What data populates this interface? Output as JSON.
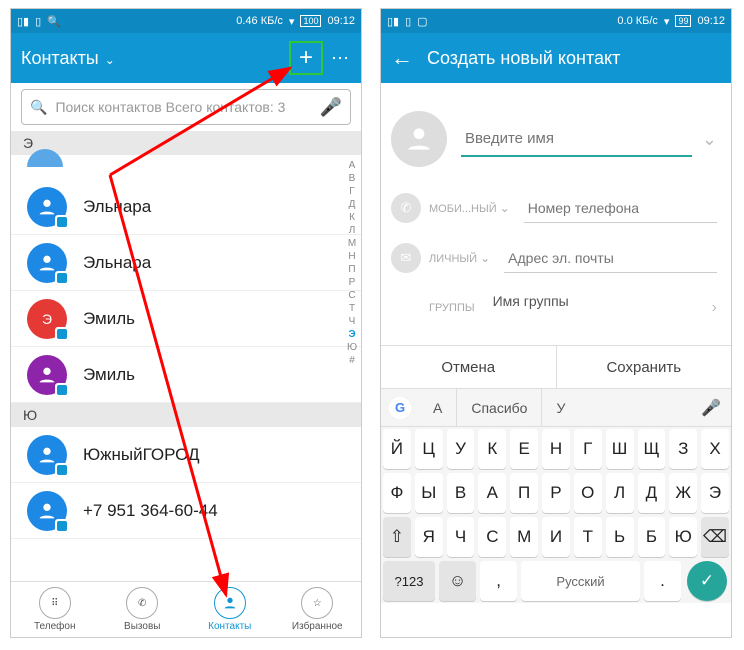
{
  "statusbar": {
    "data_rate_left": "0.46 КБ/с",
    "data_rate_right": "0.0 КБ/с",
    "battery_left": "100",
    "battery_right": "99",
    "time": "09:12"
  },
  "left": {
    "title": "Контакты",
    "search_placeholder": "Поиск контактов Всего контактов: 3",
    "sections": {
      "e_header": "Э",
      "yu_header": "Ю"
    },
    "contacts": [
      {
        "name": "Эльнара",
        "color": "#1e88e5"
      },
      {
        "name": "Эльнара",
        "color": "#1e88e5"
      },
      {
        "name": "Эмиль",
        "color": "#e53935"
      },
      {
        "name": "Эмиль",
        "color": "#8e24aa"
      },
      {
        "name": "ЮжныйГОРОД",
        "color": "#1e88e5"
      },
      {
        "name": "+7 951 364-60-44",
        "color": "#1e88e5"
      }
    ],
    "index": [
      "А",
      "В",
      "Г",
      "Д",
      "К",
      "Л",
      "М",
      "Н",
      "П",
      "Р",
      "С",
      "Т",
      "Ч",
      "Э",
      "Ю",
      "#"
    ],
    "nav": {
      "phone": "Телефон",
      "calls": "Вызовы",
      "contacts": "Контакты",
      "fav": "Избранное"
    }
  },
  "right": {
    "title": "Создать новый контакт",
    "name_placeholder": "Введите имя",
    "mobile_label": "МОБИ...НЫЙ",
    "mobile_placeholder": "Номер телефона",
    "email_label": "ЛИЧНЫЙ",
    "email_placeholder": "Адрес эл. почты",
    "groups_label": "ГРУППЫ",
    "groups_value": "Имя группы",
    "cancel": "Отмена",
    "save": "Сохранить",
    "suggestions": {
      "a": "А",
      "spasibo": "Спасибо",
      "u": "У"
    },
    "keyboard": {
      "r1": [
        "Й",
        "Ц",
        "У",
        "К",
        "Е",
        "Н",
        "Г",
        "Ш",
        "Щ",
        "З",
        "Х"
      ],
      "r2": [
        "Ф",
        "Ы",
        "В",
        "А",
        "П",
        "Р",
        "О",
        "Л",
        "Д",
        "Ж",
        "Э"
      ],
      "r3_shift": "⇧",
      "r3": [
        "Я",
        "Ч",
        "С",
        "М",
        "И",
        "Т",
        "Ь",
        "Б",
        "Ю"
      ],
      "r3_del": "⌫",
      "r4_123": "?123",
      "r4_emoji": "☺",
      "r4_comma": ",",
      "r4_space": "Русский",
      "r4_dot": "."
    }
  }
}
